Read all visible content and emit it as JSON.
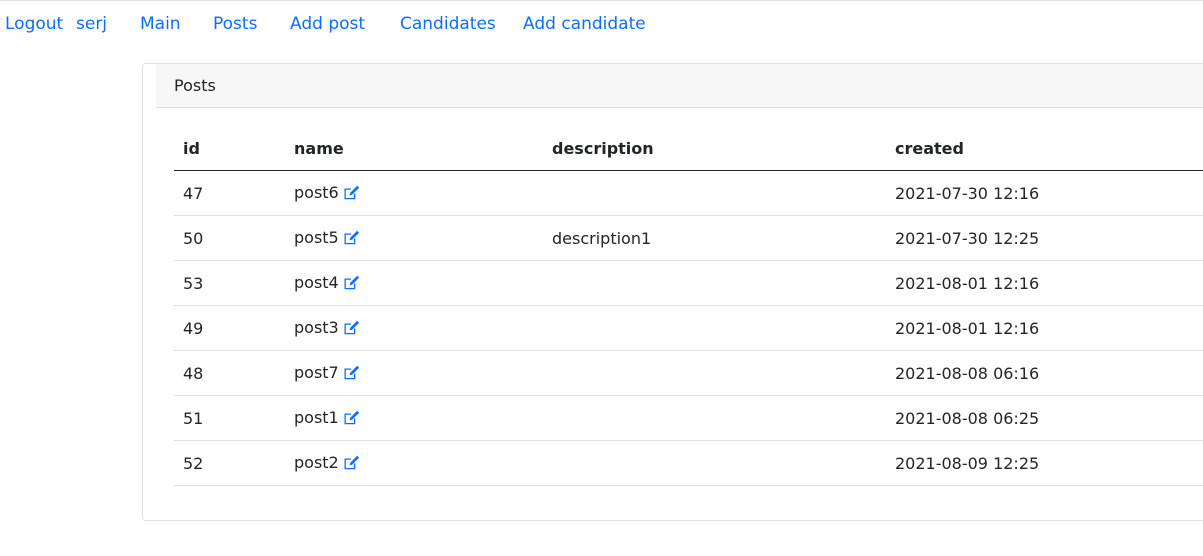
{
  "nav": {
    "logout": "Logout",
    "user": "serj",
    "main": "Main",
    "posts": "Posts",
    "add_post": "Add post",
    "candidates": "Candidates",
    "add_candidate": "Add candidate"
  },
  "card": {
    "header": "Posts"
  },
  "table": {
    "columns": [
      "id",
      "name",
      "description",
      "created"
    ],
    "rows": [
      {
        "id": "47",
        "name": "post6",
        "description": "",
        "created": "2021-07-30 12:16"
      },
      {
        "id": "50",
        "name": "post5",
        "description": "description1",
        "created": "2021-07-30 12:25"
      },
      {
        "id": "53",
        "name": "post4",
        "description": "",
        "created": "2021-08-01 12:16"
      },
      {
        "id": "49",
        "name": "post3",
        "description": "",
        "created": "2021-08-01 12:16"
      },
      {
        "id": "48",
        "name": "post7",
        "description": "",
        "created": "2021-08-08 06:16"
      },
      {
        "id": "51",
        "name": "post1",
        "description": "",
        "created": "2021-08-08 06:25"
      },
      {
        "id": "52",
        "name": "post2",
        "description": "",
        "created": "2021-08-09 12:25"
      }
    ]
  },
  "icons": {
    "edit": "edit-icon"
  },
  "colors": {
    "link": "#0d6efd",
    "header_bg": "#f7f7f7"
  }
}
